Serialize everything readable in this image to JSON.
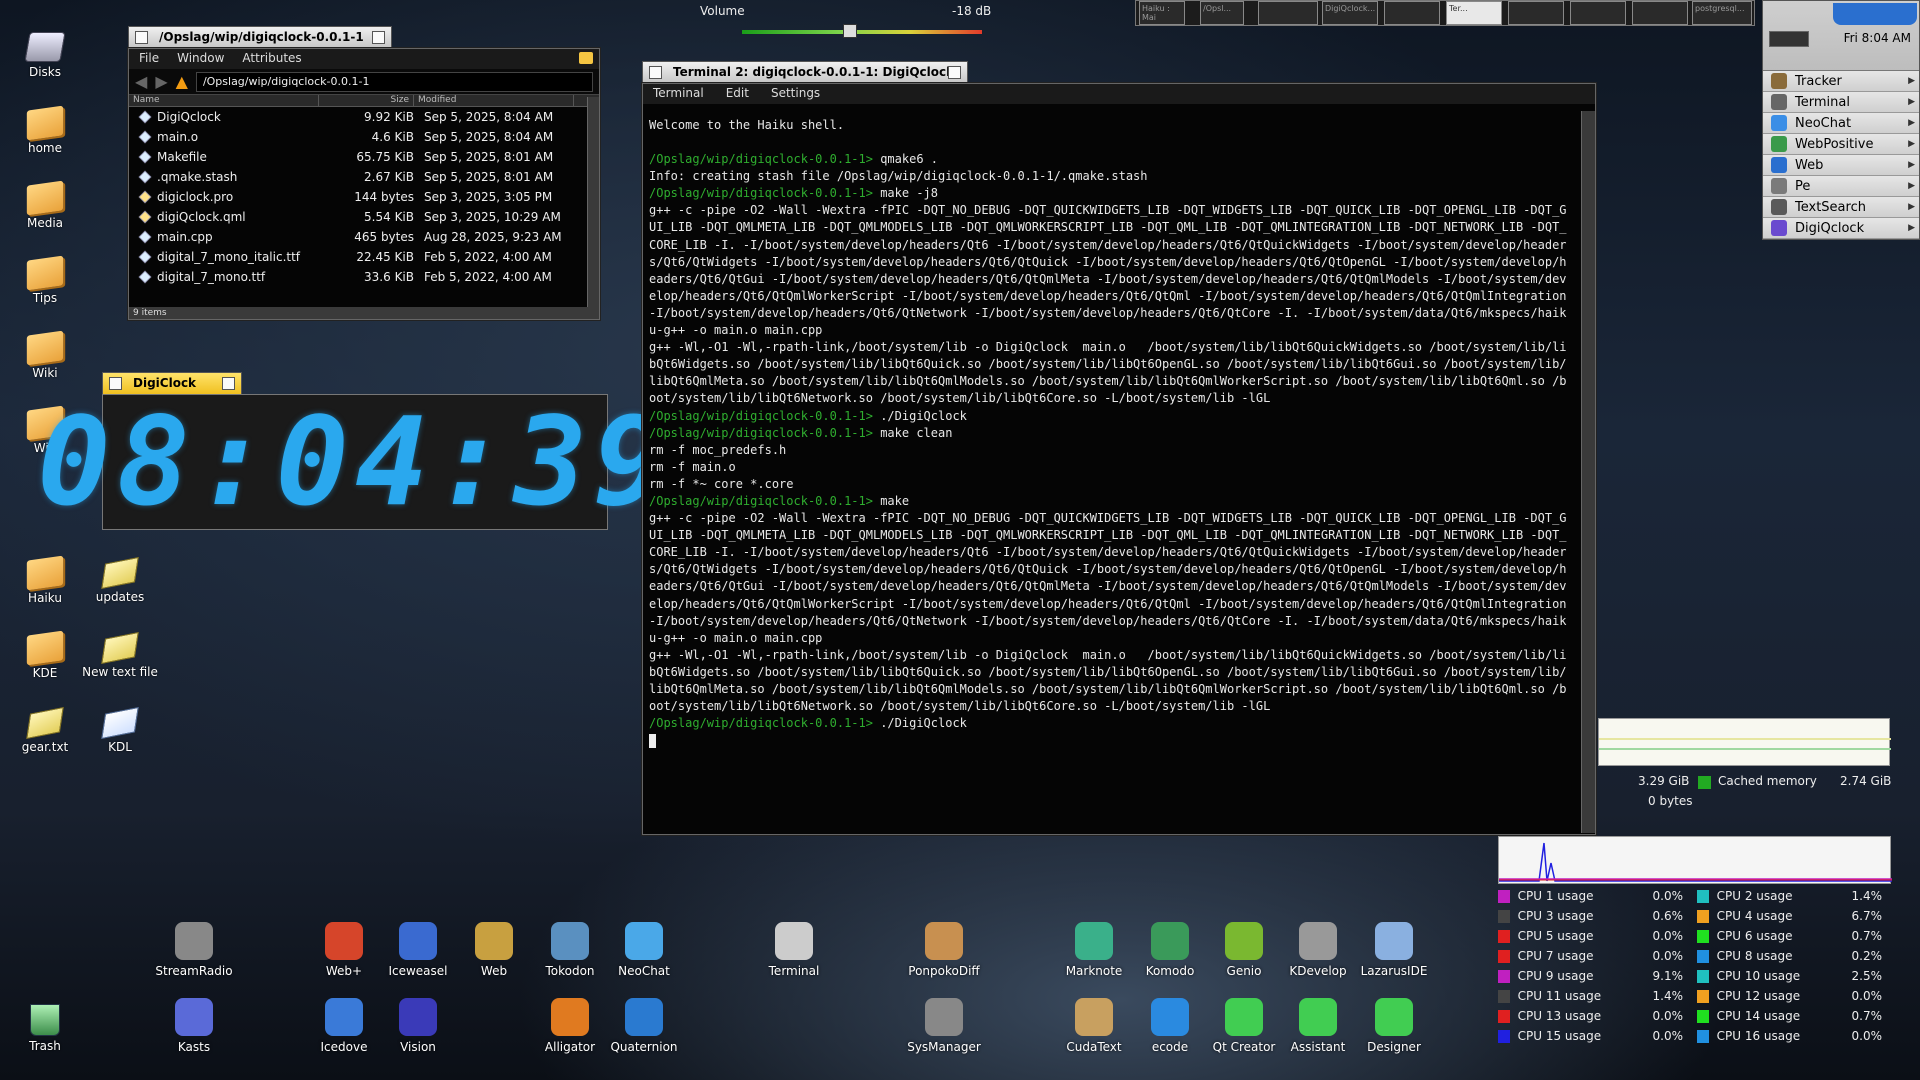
{
  "desktop_icons": [
    {
      "label": "Disks",
      "kind": "disk"
    },
    {
      "label": "home",
      "kind": "folder"
    },
    {
      "label": "Media",
      "kind": "folder"
    },
    {
      "label": "Tips",
      "kind": "folder"
    },
    {
      "label": "Wiki",
      "kind": "folder"
    },
    {
      "label": "Wip",
      "kind": "folder"
    },
    {
      "label": "Haiku",
      "kind": "folder"
    },
    {
      "label": "updates",
      "kind": "paper"
    },
    {
      "label": "KDE",
      "kind": "folder"
    },
    {
      "label": "New text file",
      "kind": "paper"
    },
    {
      "label": "gear.txt",
      "kind": "paper"
    },
    {
      "label": "KDL",
      "kind": "paper-blue"
    },
    {
      "label": "Trash",
      "kind": "trash"
    }
  ],
  "volume": {
    "label": "Volume",
    "value": "-18 dB",
    "level": 0.45
  },
  "tracker": {
    "title": "/Opslag/wip/digiqclock-0.0.1-1",
    "menu": [
      "File",
      "Window",
      "Attributes"
    ],
    "path": "/Opslag/wip/digiqclock-0.0.1-1",
    "columns": [
      "Name",
      "Size",
      "Modified"
    ],
    "files": [
      {
        "name": "DigiQclock",
        "size": "9.92 KiB",
        "modified": "Sep 5, 2025, 8:04 AM"
      },
      {
        "name": "main.o",
        "size": "4.6 KiB",
        "modified": "Sep 5, 2025, 8:04 AM"
      },
      {
        "name": "Makefile",
        "size": "65.75 KiB",
        "modified": "Sep 5, 2025, 8:01 AM"
      },
      {
        "name": ".qmake.stash",
        "size": "2.67 KiB",
        "modified": "Sep 5, 2025, 8:01 AM"
      },
      {
        "name": "digiclock.pro",
        "size": "144 bytes",
        "modified": "Sep 3, 2025, 3:05 PM"
      },
      {
        "name": "digiQclock.qml",
        "size": "5.54 KiB",
        "modified": "Sep 3, 2025, 10:29 AM"
      },
      {
        "name": "main.cpp",
        "size": "465 bytes",
        "modified": "Aug 28, 2025, 9:23 AM"
      },
      {
        "name": "digital_7_mono_italic.ttf",
        "size": "22.45 KiB",
        "modified": "Feb 5, 2022, 4:00 AM"
      },
      {
        "name": "digital_7_mono.ttf",
        "size": "33.6 KiB",
        "modified": "Feb 5, 2022, 4:00 AM"
      }
    ],
    "status": "9 items"
  },
  "digiclock": {
    "title": "DigiClock",
    "time": "08:04:39"
  },
  "terminal": {
    "title": "Terminal 2: digiqclock-0.0.1-1: DigiQclock",
    "menu": [
      "Terminal",
      "Edit",
      "Settings"
    ],
    "lines": [
      {
        "t": "out",
        "text": "Welcome to the Haiku shell."
      },
      {
        "t": "out",
        "text": ""
      },
      {
        "t": "cmd",
        "prompt": "/Opslag/wip/digiqclock-0.0.1-1>",
        "text": " qmake6 ."
      },
      {
        "t": "out",
        "text": "Info: creating stash file /Opslag/wip/digiqclock-0.0.1-1/.qmake.stash"
      },
      {
        "t": "cmd",
        "prompt": "/Opslag/wip/digiqclock-0.0.1-1>",
        "text": " make -j8"
      },
      {
        "t": "out",
        "text": "g++ -c -pipe -O2 -Wall -Wextra -fPIC -DQT_NO_DEBUG -DQT_QUICKWIDGETS_LIB -DQT_WIDGETS_LIB -DQT_QUICK_LIB -DQT_OPENGL_LIB -DQT_GUI_LIB -DQT_QMLMETA_LIB -DQT_QMLMODELS_LIB -DQT_QMLWORKERSCRIPT_LIB -DQT_QML_LIB -DQT_QMLINTEGRATION_LIB -DQT_NETWORK_LIB -DQT_CORE_LIB -I. -I/boot/system/develop/headers/Qt6 -I/boot/system/develop/headers/Qt6/QtQuickWidgets -I/boot/system/develop/headers/Qt6/QtWidgets -I/boot/system/develop/headers/Qt6/QtQuick -I/boot/system/develop/headers/Qt6/QtOpenGL -I/boot/system/develop/headers/Qt6/QtGui -I/boot/system/develop/headers/Qt6/QtQmlMeta -I/boot/system/develop/headers/Qt6/QtQmlModels -I/boot/system/develop/headers/Qt6/QtQmlWorkerScript -I/boot/system/develop/headers/Qt6/QtQml -I/boot/system/develop/headers/Qt6/QtQmlIntegration -I/boot/system/develop/headers/Qt6/QtNetwork -I/boot/system/develop/headers/Qt6/QtCore -I. -I/boot/system/data/Qt6/mkspecs/haiku-g++ -o main.o main.cpp"
      },
      {
        "t": "out",
        "text": "g++ -Wl,-O1 -Wl,-rpath-link,/boot/system/lib -o DigiQclock  main.o   /boot/system/lib/libQt6QuickWidgets.so /boot/system/lib/libQt6Widgets.so /boot/system/lib/libQt6Quick.so /boot/system/lib/libQt6OpenGL.so /boot/system/lib/libQt6Gui.so /boot/system/lib/libQt6QmlMeta.so /boot/system/lib/libQt6QmlModels.so /boot/system/lib/libQt6QmlWorkerScript.so /boot/system/lib/libQt6Qml.so /boot/system/lib/libQt6Network.so /boot/system/lib/libQt6Core.so -L/boot/system/lib -lGL"
      },
      {
        "t": "cmd",
        "prompt": "/Opslag/wip/digiqclock-0.0.1-1>",
        "text": " ./DigiQclock"
      },
      {
        "t": "cmd",
        "prompt": "/Opslag/wip/digiqclock-0.0.1-1>",
        "text": " make clean"
      },
      {
        "t": "out",
        "text": "rm -f moc_predefs.h"
      },
      {
        "t": "out",
        "text": "rm -f main.o"
      },
      {
        "t": "out",
        "text": "rm -f *~ core *.core"
      },
      {
        "t": "cmd",
        "prompt": "/Opslag/wip/digiqclock-0.0.1-1>",
        "text": " make"
      },
      {
        "t": "out",
        "text": "g++ -c -pipe -O2 -Wall -Wextra -fPIC -DQT_NO_DEBUG -DQT_QUICKWIDGETS_LIB -DQT_WIDGETS_LIB -DQT_QUICK_LIB -DQT_OPENGL_LIB -DQT_GUI_LIB -DQT_QMLMETA_LIB -DQT_QMLMODELS_LIB -DQT_QMLWORKERSCRIPT_LIB -DQT_QML_LIB -DQT_QMLINTEGRATION_LIB -DQT_NETWORK_LIB -DQT_CORE_LIB -I. -I/boot/system/develop/headers/Qt6 -I/boot/system/develop/headers/Qt6/QtQuickWidgets -I/boot/system/develop/headers/Qt6/QtWidgets -I/boot/system/develop/headers/Qt6/QtQuick -I/boot/system/develop/headers/Qt6/QtOpenGL -I/boot/system/develop/headers/Qt6/QtGui -I/boot/system/develop/headers/Qt6/QtQmlMeta -I/boot/system/develop/headers/Qt6/QtQmlModels -I/boot/system/develop/headers/Qt6/QtQmlWorkerScript -I/boot/system/develop/headers/Qt6/QtQml -I/boot/system/develop/headers/Qt6/QtQmlIntegration -I/boot/system/develop/headers/Qt6/QtNetwork -I/boot/system/develop/headers/Qt6/QtCore -I. -I/boot/system/data/Qt6/mkspecs/haiku-g++ -o main.o main.cpp"
      },
      {
        "t": "out",
        "text": "g++ -Wl,-O1 -Wl,-rpath-link,/boot/system/lib -o DigiQclock  main.o   /boot/system/lib/libQt6QuickWidgets.so /boot/system/lib/libQt6Widgets.so /boot/system/lib/libQt6Quick.so /boot/system/lib/libQt6OpenGL.so /boot/system/lib/libQt6Gui.so /boot/system/lib/libQt6QmlMeta.so /boot/system/lib/libQt6QmlModels.so /boot/system/lib/libQt6QmlWorkerScript.so /boot/system/lib/libQt6Qml.so /boot/system/lib/libQt6Network.so /boot/system/lib/libQt6Core.so -L/boot/system/lib -lGL"
      },
      {
        "t": "cmd",
        "prompt": "/Opslag/wip/digiqclock-0.0.1-1>",
        "text": " ./DigiQclock"
      }
    ]
  },
  "deskbar": {
    "time": "Fri 8:04 AM",
    "items": [
      {
        "label": "Tracker",
        "color": "#8a6b3a"
      },
      {
        "label": "Terminal",
        "color": "#666"
      },
      {
        "label": "NeoChat",
        "color": "#3a8ee6"
      },
      {
        "label": "WebPositive",
        "color": "#3a9a4a"
      },
      {
        "label": "Web",
        "color": "#2a6fcf"
      },
      {
        "label": "Pe",
        "color": "#7a7a7a"
      },
      {
        "label": "TextSearch",
        "color": "#5a5a5a"
      },
      {
        "label": "DigiQclock",
        "color": "#6a4acf"
      }
    ]
  },
  "workspaces": [
    "Haiku : Mai",
    "/Opsl...",
    "DigiQclock...",
    "Ter...",
    "postgresql..."
  ],
  "memory": {
    "used": "3.29 GiB",
    "swap": "0 bytes",
    "cached_label": "Cached memory",
    "cached": "2.74 GiB",
    "cached_color": "#22aa22"
  },
  "cpu": [
    {
      "label": "CPU 1 usage",
      "value": "0.0%",
      "color": "#c020c0"
    },
    {
      "label": "CPU 2 usage",
      "value": "1.4%",
      "color": "#20c0c0"
    },
    {
      "label": "CPU 3 usage",
      "value": "0.6%",
      "color": "#444444"
    },
    {
      "label": "CPU 4 usage",
      "value": "6.7%",
      "color": "#f0a020"
    },
    {
      "label": "CPU 5 usage",
      "value": "0.0%",
      "color": "#e02020"
    },
    {
      "label": "CPU 6 usage",
      "value": "0.7%",
      "color": "#20e020"
    },
    {
      "label": "CPU 7 usage",
      "value": "0.0%",
      "color": "#e02020"
    },
    {
      "label": "CPU 8 usage",
      "value": "0.2%",
      "color": "#2090e0"
    },
    {
      "label": "CPU 9 usage",
      "value": "9.1%",
      "color": "#c020c0"
    },
    {
      "label": "CPU 10 usage",
      "value": "2.5%",
      "color": "#20c0c0"
    },
    {
      "label": "CPU 11 usage",
      "value": "1.4%",
      "color": "#444444"
    },
    {
      "label": "CPU 12 usage",
      "value": "0.0%",
      "color": "#f0a020"
    },
    {
      "label": "CPU 13 usage",
      "value": "0.0%",
      "color": "#e02020"
    },
    {
      "label": "CPU 14 usage",
      "value": "0.7%",
      "color": "#20e020"
    },
    {
      "label": "CPU 15 usage",
      "value": "0.0%",
      "color": "#2020e0"
    },
    {
      "label": "CPU 16 usage",
      "value": "0.0%",
      "color": "#2090e0"
    }
  ],
  "dock_row1": [
    {
      "label": "StreamRadio",
      "color": "#888"
    },
    {
      "label": "Web+",
      "color": "#d6452a"
    },
    {
      "label": "Iceweasel",
      "color": "#3a6ad0"
    },
    {
      "label": "Web",
      "color": "#c8a040"
    },
    {
      "label": "Tokodon",
      "color": "#5a90c0"
    },
    {
      "label": "NeoChat",
      "color": "#4aa8e8"
    },
    {
      "label": "Terminal",
      "color": "#ccc"
    },
    {
      "label": "PonpokoDiff",
      "color": "#c89050"
    },
    {
      "label": "Marknote",
      "color": "#3ab08a"
    },
    {
      "label": "Komodo",
      "color": "#3a9a5a"
    },
    {
      "label": "Genio",
      "color": "#7ab830"
    },
    {
      "label": "KDevelop",
      "color": "#999"
    },
    {
      "label": "LazarusIDE",
      "color": "#8ab0e0"
    }
  ],
  "dock_row2": [
    {
      "label": "Kasts",
      "color": "#5a6ad8"
    },
    {
      "label": "Icedove",
      "color": "#3a7ad8"
    },
    {
      "label": "Vision",
      "color": "#3a3ab8"
    },
    {
      "label": "Alligator",
      "color": "#e07a20"
    },
    {
      "label": "Quaternion",
      "color": "#2a7ad0"
    },
    {
      "label": "SysManager",
      "color": "#888"
    },
    {
      "label": "CudaText",
      "color": "#c8a060"
    },
    {
      "label": "ecode",
      "color": "#2a8ae0"
    },
    {
      "label": "Qt Creator",
      "color": "#41cd52"
    },
    {
      "label": "Assistant",
      "color": "#41cd52"
    },
    {
      "label": "Designer",
      "color": "#41cd52"
    }
  ]
}
